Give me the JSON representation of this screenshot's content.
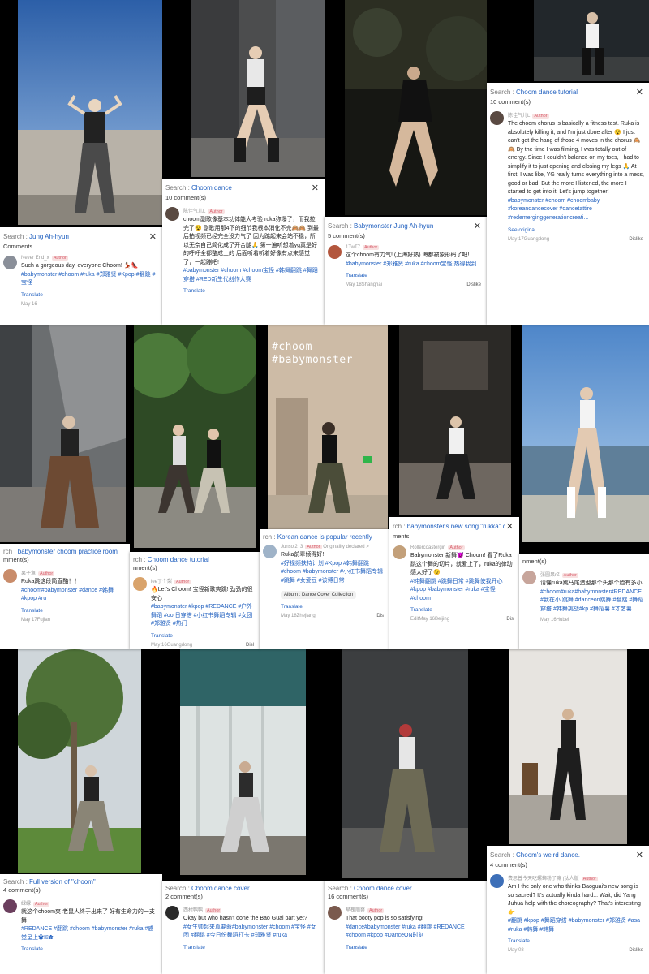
{
  "photos": [
    {
      "id": "p1",
      "theme": "blue-sky",
      "caption": ""
    },
    {
      "id": "p2",
      "theme": "night-grey",
      "caption": ""
    },
    {
      "id": "p3",
      "theme": "night-dark",
      "caption": ""
    },
    {
      "id": "p4",
      "theme": "night-dark",
      "caption": ""
    },
    {
      "id": "p5",
      "theme": "garage",
      "caption": ""
    },
    {
      "id": "p6",
      "theme": "forest",
      "caption": ""
    },
    {
      "id": "p7",
      "theme": "indoor-beige",
      "caption": "#choom\n#babymonster"
    },
    {
      "id": "p8",
      "theme": "studio-dark",
      "caption": ""
    },
    {
      "id": "p9",
      "theme": "sea-sky",
      "caption": ""
    },
    {
      "id": "p10",
      "theme": "park",
      "caption": ""
    },
    {
      "id": "p11",
      "theme": "teal-studio",
      "caption": ""
    },
    {
      "id": "p12",
      "theme": "grey-studio",
      "caption": ""
    },
    {
      "id": "p13",
      "theme": "white-room",
      "caption": ""
    }
  ],
  "cards": [
    {
      "id": "c1",
      "search_label": "Search : ",
      "query": "Jung Ah-hyun",
      "count": "Comments",
      "user": "Never End_x",
      "badge": "Author",
      "text": "Such a gorgeous day, everyone Choom! 💃🏻👠",
      "tags": "#babymonster #choom #ruka #郑雅贤 #Kpop #翻跳 #宝怪",
      "translate": "Translate",
      "footer_left": "May 16",
      "footer_right": "",
      "avatar_color": "#8a8f99"
    },
    {
      "id": "c2",
      "search_label": "Search : ",
      "query": "Choom dance",
      "count": "10 comment(s)",
      "user": "陈佳气儿L",
      "badge": "Author",
      "text": "choom副歌像基本功体能大考验 ruka弥爆了，而我拉完了😵 副歌用那4下的细节我根本消化不完🙈🙈 到最后拍视频已经完全没力气了 因为踮起来会站不稳，所以无奈自己简化成了开合腿🙏 第一遍听想着yg真是好的呼吁全都整成土的 后面听着听着好像有点来感觉了，一起蹦吧!",
      "tags": "#babymonster #choom #choom宝怪 #韩舞翻跳 #舞蹈穿搭 #RED新生代创作大赛",
      "translate": "Translate",
      "footer_left": "",
      "footer_right": "",
      "avatar_color": "#5a4a42"
    },
    {
      "id": "c3",
      "search_label": "Search : ",
      "query": "Babymonster Jung Ah-hyun",
      "count": "5 comment(s)",
      "user": "1TwT7",
      "badge": "Author",
      "text": "这个choom有力气! (上海好热) 海都被象形码了吧!",
      "tags": "#babymonster #郑雅贤 #ruka #choom宝怪 热得我到",
      "translate": "Translate",
      "footer_left": "May 18Shanghai",
      "footer_right": "Dislike",
      "avatar_color": "#b3563d"
    },
    {
      "id": "c4",
      "search_label": "Search : ",
      "query": "Choom dance tutorial",
      "count": "10 comment(s)",
      "user": "陈佳气儿L",
      "badge": "Author",
      "text": "The choom chorus is basically a fitness test. Ruka is absolutely killing it, and I'm just done after 😵 I just can't get the hang of those 4 moves in the chorus 🙈🙈 By the time I was filming, I was totally out of energy. Since I couldn't balance on my toes, I had to simplify it to just opening and closing my legs 🙏 At first, I was like, YG really turns everything into a mess, good or bad. But the more I listened, the more I started to get into it. Let's jump together!",
      "tags": "#babymonster #choom #choombaby #koreandancecover #dancetattire #redemerginggenerationcreati...",
      "translate": "See original",
      "footer_left": "May 17Guangdong",
      "footer_right": "Dislike",
      "avatar_color": "#5a4a42"
    },
    {
      "id": "c5",
      "search_label": "rch : ",
      "query": "babymonster choom practice room",
      "count": "mment(s)",
      "user": "果子鱼",
      "badge": "Author",
      "text": "Ruka跳这段简直酷！！",
      "tags": "#choom#babymonster #dance #韩舞 #kpop #ru",
      "translate": "Translate",
      "footer_left": "May 17Fujian",
      "footer_right": "",
      "avatar_color": "#c98c6a"
    },
    {
      "id": "c6",
      "search_label": "rch : ",
      "query": "Choom dance tutorial",
      "count": "nment(s)",
      "user": "lee了个梨",
      "badge": "Author",
      "text": "🔥Let's Choom! 宝怪新歌爽跳! 劲劲的很安心",
      "tags": "#babymonster #kpop #REDANCE #户外舞蹈 #oo 日穿搭 #小红书舞蹈专辑 #女团 #郑雅贤 #热门",
      "translate": "Translate",
      "footer_left": "May 16Guangdong",
      "footer_right": "Disl",
      "avatar_color": "#d9a36b"
    },
    {
      "id": "c7",
      "search_label": "rch : ",
      "query": "Korean dance is popular recently",
      "count": "",
      "user": "Junsol2_3",
      "badge": "Author",
      "text": "Ruka前辈倾得好!",
      "tags": "#好视频扶持计划 #Kpop #韩舞翻跳 #choom #babymonster #小红书舞蹈专辑 #跳舞 #女爱豆 #该博日常",
      "translate": "Translate",
      "footer_left": "May 18Zhejiang",
      "footer_right": "Dis",
      "album": "Album : Dance Cover Collection",
      "extra": "Originality declared >",
      "avatar_color": "#9fb3c8"
    },
    {
      "id": "c8",
      "search_label": "rch : ",
      "query": "babymonster's new song \"rukka\" cho...",
      "count": "ments",
      "user": "Rollercoastergirl",
      "badge": "Author",
      "text": "Babymonster 新舞😈 Choom! 看了Ruka跳这个舞的切片，就爱上了，ruka的律动感太好了😉",
      "tags": "#韩舞翻跳 #跳舞日常 #跳舞使我开心 #kpop #babymonster #ruka #宝怪 #choom",
      "translate": "Translate",
      "footer_left": "EditMay 16Beijing",
      "footer_right": "Dis",
      "avatar_color": "#c3a07a"
    },
    {
      "id": "c9",
      "search_label": "",
      "query": "",
      "count": "nment(s)",
      "user": "张圆果rZ",
      "badge": "Author",
      "text": "请懂ruka跳马尾造型那个头那个脸有多小!",
      "tags": "#choom#ruka#babymonster#REDANCE #我在小 跳舞 #danceon跳舞 #翻跳 #舞蹈穿搭 #韩舞挑战#kp #舞蹈薯 #才艺薯",
      "translate": "",
      "footer_left": "May 16Hubei",
      "footer_right": "",
      "avatar_color": "#c7a59b"
    },
    {
      "id": "c10",
      "search_label": "Search : ",
      "query": "Full version of \"choom\"",
      "count": "4 comment(s)",
      "user": "绿绿",
      "badge": "Author",
      "text": "就这个choom爽 老鼠人终于出来了 好有生命力的一支舞",
      "tags": "#REDANCE #翻跳 #choom #babymonster #ruka #惑 觉呈上✿ꕤ✿",
      "translate": "Translate",
      "footer_left": "",
      "footer_right": "",
      "avatar_color": "#6b3f5e"
    },
    {
      "id": "c11",
      "search_label": "Search : ",
      "query": "Choom dance cover",
      "count": "2 comment(s)",
      "user": "西村鸭鸭",
      "badge": "Author",
      "text": "Okay but who hasn't done the Bao Guai part yet?",
      "tags": "#女生帅起来真要命#babymonster #choom #宝怪 #女团 #翻跳 #今日份舞蹈打卡 #郑雅贤 #ruka",
      "translate": "Translate",
      "footer_left": "",
      "footer_right": "",
      "avatar_color": "#2a2a2a"
    },
    {
      "id": "c12",
      "search_label": "Search : ",
      "query": "Choom dance cover",
      "count": "16 comment(s)",
      "user": "星槐丽爽",
      "badge": "Author",
      "text": "That booty pop is so satisfying!",
      "tags": "#dance#babymonster #ruka #翻跳 #REDANCE #choom #kpop #DanceON时刻",
      "translate": "Translate",
      "footer_left": "",
      "footer_right": "",
      "avatar_color": "#7a5a4e"
    },
    {
      "id": "c13",
      "search_label": "Search : ",
      "query": "Choom's weird dance.",
      "count": "4 comment(s)",
      "user": "费思普今天吃螺蛳粉了嘛 (汰人版",
      "badge": "Author",
      "text": "Am I the only one who thinks Baoguai's new song is so sacred? It's actually kinda hard... Wait, did Yang Juhua help with the choreography? That's interesting👉",
      "tags": "#翻跳 #kpop #舞蹈穿搭 #babymonster #郑雅贤 #asa #ruka #韩舞 #韩舞",
      "translate": "Translate",
      "footer_left": "May 08",
      "footer_right": "Dislike",
      "avatar_color": "#3d6fb8"
    }
  ]
}
